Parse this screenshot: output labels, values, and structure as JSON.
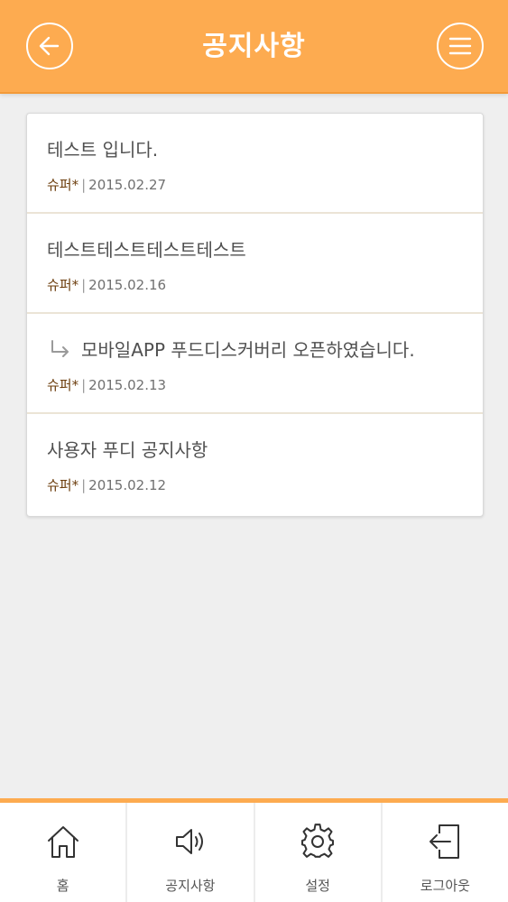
{
  "header": {
    "title": "공지사항",
    "back_icon": "arrow-left-icon",
    "menu_icon": "hamburger-menu-icon"
  },
  "colors": {
    "accent": "#fdab50",
    "author": "#6b3c0b",
    "text": "#505050"
  },
  "notices": [
    {
      "title": "테스트 입니다.",
      "author": "슈퍼*",
      "separator": "|",
      "date": "2015.02.27",
      "reply": false
    },
    {
      "title": "테스트테스트테스트테스트",
      "author": "슈퍼*",
      "separator": "|",
      "date": "2015.02.16",
      "reply": false
    },
    {
      "title": "모바일APP 푸드디스커버리 오픈하였습니다.",
      "author": "슈퍼*",
      "separator": "|",
      "date": "2015.02.13",
      "reply": true
    },
    {
      "title": "사용자 푸디 공지사항",
      "author": "슈퍼*",
      "separator": "|",
      "date": "2015.02.12",
      "reply": false
    }
  ],
  "bottom_nav": {
    "items": [
      {
        "label": "홈",
        "icon": "home-icon"
      },
      {
        "label": "공지사항",
        "icon": "speaker-icon"
      },
      {
        "label": "설정",
        "icon": "gear-icon"
      },
      {
        "label": "로그아웃",
        "icon": "logout-icon"
      }
    ]
  }
}
